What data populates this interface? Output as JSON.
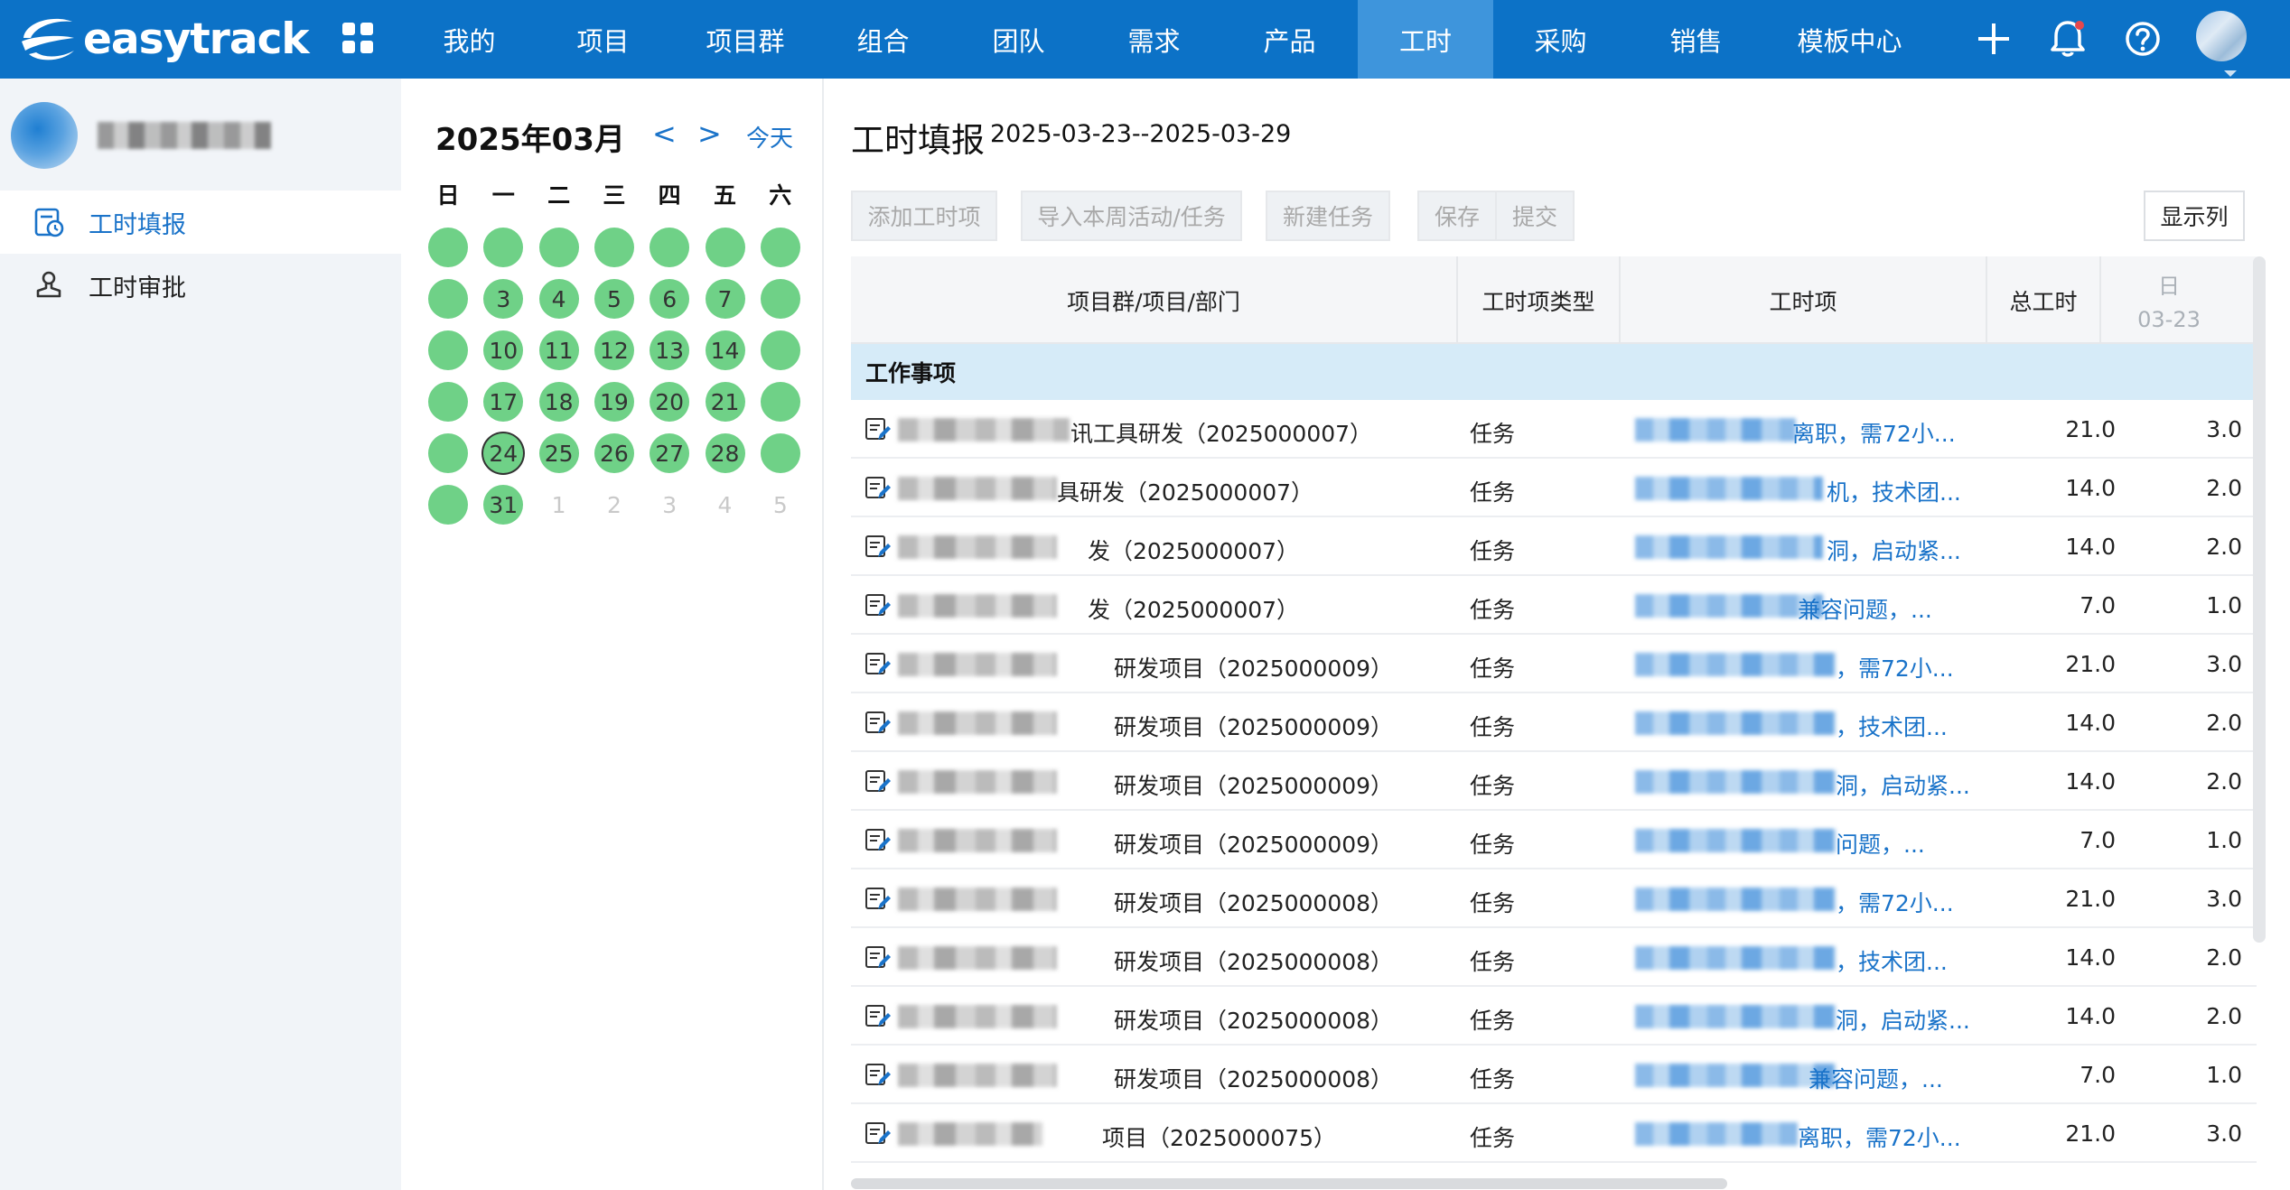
{
  "app": {
    "logo_text": "easytrack"
  },
  "nav": {
    "items": [
      {
        "label": "我的"
      },
      {
        "label": "项目"
      },
      {
        "label": "项目群"
      },
      {
        "label": "组合"
      },
      {
        "label": "团队"
      },
      {
        "label": "需求"
      },
      {
        "label": "产品"
      },
      {
        "label": "工时"
      },
      {
        "label": "采购"
      },
      {
        "label": "销售"
      },
      {
        "label": "模板中心"
      }
    ],
    "active": "工时",
    "icons": [
      "apps-grid-icon",
      "plus-icon",
      "bell-icon",
      "help-icon"
    ],
    "notification_dot_color": "#e5484d"
  },
  "sidebar": {
    "items": [
      {
        "label": "工时填报",
        "icon": "timesheet-icon",
        "active": true
      },
      {
        "label": "工时审批",
        "icon": "approval-stamp-icon",
        "active": false
      }
    ]
  },
  "calendar": {
    "title": "2025年03月",
    "prev": "<",
    "next": ">",
    "today": "今天",
    "weekdays": [
      "日",
      "一",
      "二",
      "三",
      "四",
      "五",
      "六"
    ],
    "weeks": [
      [
        "",
        "",
        "",
        "",
        "",
        "",
        ""
      ],
      [
        "",
        "3",
        "4",
        "5",
        "6",
        "7",
        ""
      ],
      [
        "",
        "10",
        "11",
        "12",
        "13",
        "14",
        ""
      ],
      [
        "",
        "17",
        "18",
        "19",
        "20",
        "21",
        ""
      ],
      [
        "",
        "24",
        "25",
        "26",
        "27",
        "28",
        ""
      ],
      [
        "",
        "31",
        "1",
        "2",
        "3",
        "4",
        "5"
      ]
    ],
    "selected_day": "24",
    "filled_color": "#6fd187"
  },
  "main": {
    "title": "工时填报",
    "date_range": "2025-03-23--2025-03-29",
    "toolbar": {
      "add": "添加工时项",
      "import": "导入本周活动/任务",
      "new_task": "新建任务",
      "save": "保存",
      "submit": "提交",
      "columns": "显示列"
    },
    "table": {
      "headers": {
        "project": "项目群/项目/部门",
        "type": "工时项类型",
        "item": "工时项",
        "total": "总工时",
        "day_name": "日",
        "day_date": "03-23"
      },
      "group": "工作事项",
      "rows": [
        {
          "project": "讯工具研发（2025000007）",
          "type": "任务",
          "item": "离职，需72小...",
          "total": "21.0",
          "day": "3.0"
        },
        {
          "project": "具研发（2025000007）",
          "type": "任务",
          "item": "机，技术团...",
          "total": "14.0",
          "day": "2.0"
        },
        {
          "project": "发（2025000007）",
          "type": "任务",
          "item": "洞，启动紧...",
          "total": "14.0",
          "day": "2.0"
        },
        {
          "project": "发（2025000007）",
          "type": "任务",
          "item": "兼容问题，...",
          "total": "7.0",
          "day": "1.0"
        },
        {
          "project": "研发项目（2025000009）",
          "type": "任务",
          "item": "，需72小...",
          "total": "21.0",
          "day": "3.0"
        },
        {
          "project": "研发项目（2025000009）",
          "type": "任务",
          "item": "，技术团...",
          "total": "14.0",
          "day": "2.0"
        },
        {
          "project": "研发项目（2025000009）",
          "type": "任务",
          "item": "洞，启动紧...",
          "total": "14.0",
          "day": "2.0"
        },
        {
          "project": "研发项目（2025000009）",
          "type": "任务",
          "item": "问题，...",
          "total": "7.0",
          "day": "1.0"
        },
        {
          "project": "研发项目（2025000008）",
          "type": "任务",
          "item": "，需72小...",
          "total": "21.0",
          "day": "3.0"
        },
        {
          "project": "研发项目（2025000008）",
          "type": "任务",
          "item": "，技术团...",
          "total": "14.0",
          "day": "2.0"
        },
        {
          "project": "研发项目（2025000008）",
          "type": "任务",
          "item": "洞，启动紧...",
          "total": "14.0",
          "day": "2.0"
        },
        {
          "project": "研发项目（2025000008）",
          "type": "任务",
          "item": "兼容问题，...",
          "total": "7.0",
          "day": "1.0"
        },
        {
          "project": "项目（2025000075）",
          "type": "任务",
          "item": "离职，需72小...",
          "total": "21.0",
          "day": "3.0"
        }
      ]
    }
  }
}
